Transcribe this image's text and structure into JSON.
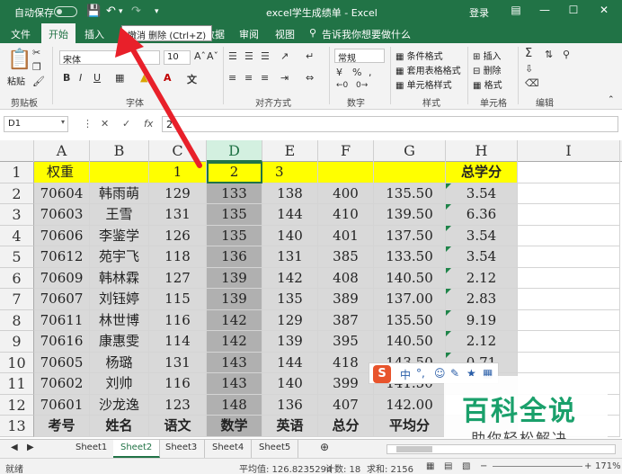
{
  "titlebar": {
    "autosave_label": "自动保存",
    "title": "excel学生成绩单  -  Excel",
    "login": "登录"
  },
  "tabs": [
    "文件",
    "开始",
    "插入"
  ],
  "tabs_right": [
    "数据",
    "审阅",
    "视图"
  ],
  "tell_me": "告诉我你想要做什么",
  "share": "共享",
  "tooltip": "撤消 删除 (Ctrl+Z)",
  "ribbon": {
    "paste": "粘贴",
    "clipboard_label": "剪贴板",
    "font_name": "宋体",
    "font_size": "10",
    "font_label": "字体",
    "align_label": "对齐方式",
    "number_format": "常规",
    "number_label": "数字",
    "styles": [
      "条件格式",
      "套用表格格式",
      "单元格样式"
    ],
    "styles_label": "样式",
    "cells": [
      "插入",
      "删除",
      "格式"
    ],
    "cells_label": "单元格",
    "edit_label": "编辑"
  },
  "formula_bar": {
    "name_box": "D1",
    "formula": "2"
  },
  "columns": [
    "A",
    "B",
    "C",
    "D",
    "E",
    "F",
    "G",
    "H",
    "I"
  ],
  "rows": [
    [
      "权重",
      "",
      "1",
      "2",
      "3",
      "",
      "",
      "总学分"
    ],
    [
      "70604",
      "韩雨萌",
      "129",
      "133",
      "138",
      "400",
      "135.50",
      "3.54"
    ],
    [
      "70603",
      "王雪",
      "131",
      "135",
      "144",
      "410",
      "139.50",
      "6.36"
    ],
    [
      "70606",
      "李鉴学",
      "126",
      "135",
      "140",
      "401",
      "137.50",
      "3.54"
    ],
    [
      "70612",
      "苑宇飞",
      "118",
      "136",
      "131",
      "385",
      "133.50",
      "3.54"
    ],
    [
      "70609",
      "韩林霖",
      "127",
      "139",
      "142",
      "408",
      "140.50",
      "2.12"
    ],
    [
      "70607",
      "刘钰婷",
      "115",
      "139",
      "135",
      "389",
      "137.00",
      "2.83"
    ],
    [
      "70611",
      "林世博",
      "116",
      "142",
      "129",
      "387",
      "135.50",
      "9.19"
    ],
    [
      "70616",
      "康惠雯",
      "114",
      "142",
      "139",
      "395",
      "140.50",
      "2.12"
    ],
    [
      "70605",
      "杨璐",
      "131",
      "143",
      "144",
      "418",
      "143.50",
      "0.71"
    ],
    [
      "70602",
      "刘帅",
      "116",
      "143",
      "140",
      "399",
      "141.50",
      ""
    ],
    [
      "70601",
      "沙龙逸",
      "123",
      "148",
      "136",
      "407",
      "142.00",
      ""
    ],
    [
      "考号",
      "姓名",
      "语文",
      "数学",
      "英语",
      "总分",
      "平均分",
      ""
    ]
  ],
  "sheets": [
    "Sheet1",
    "Sheet2",
    "Sheet3",
    "Sheet4",
    "Sheet5"
  ],
  "active_sheet": "Sheet2",
  "status": {
    "ready": "就绪",
    "average": "平均值: 126.8235294",
    "count": "计数: 18",
    "sum": "求和: 2156",
    "zoom": "171%"
  },
  "watermark": {
    "title": "百科全说",
    "subtitle": "助你轻松解决"
  },
  "sogou": {
    "logo": "S",
    "mode": "中"
  },
  "colors": {
    "excel_green": "#217346",
    "header_yellow": "#ffff00",
    "selected_col": "#b0b0b0",
    "h_col_gray": "#d9d9d9",
    "arrow_red": "#e8202a"
  }
}
